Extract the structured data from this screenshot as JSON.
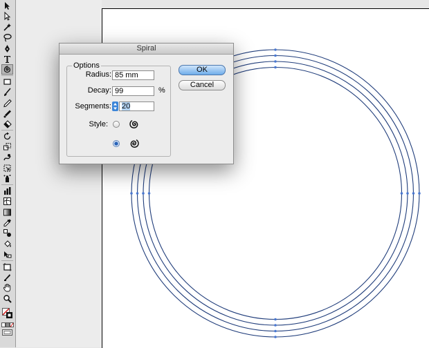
{
  "toolbar": {
    "tools": [
      {
        "icon": "selection-arrow-icon"
      },
      {
        "icon": "direct-selection-icon"
      },
      {
        "icon": "magic-wand-icon"
      },
      {
        "icon": "lasso-icon"
      },
      {
        "icon": "pen-icon"
      },
      {
        "icon": "type-icon",
        "glyph": "T"
      },
      {
        "icon": "spiral-tool-icon",
        "active": true
      },
      {
        "icon": "rectangle-icon"
      },
      {
        "icon": "paintbrush-icon"
      },
      {
        "icon": "pencil-icon"
      },
      {
        "icon": "blob-brush-icon"
      },
      {
        "icon": "eraser-icon"
      },
      {
        "icon": "rotate-icon"
      },
      {
        "icon": "scale-icon"
      },
      {
        "icon": "warp-icon"
      },
      {
        "icon": "free-transform-icon"
      },
      {
        "icon": "symbol-sprayer-icon"
      },
      {
        "icon": "column-graph-icon"
      },
      {
        "icon": "mesh-icon"
      },
      {
        "icon": "gradient-icon"
      },
      {
        "icon": "eyedropper-icon"
      },
      {
        "icon": "blend-icon"
      },
      {
        "icon": "live-paint-bucket-icon"
      },
      {
        "icon": "live-paint-selection-icon"
      },
      {
        "icon": "artboard-icon"
      },
      {
        "icon": "slice-icon"
      },
      {
        "icon": "hand-icon"
      },
      {
        "icon": "zoom-icon"
      }
    ]
  },
  "dialog": {
    "title": "Spiral",
    "options_legend": "Options",
    "radius_label": "Radius:",
    "radius_value": "85 mm",
    "decay_label": "Decay:",
    "decay_value": "99",
    "decay_unit": "%",
    "segments_label": "Segments:",
    "segments_value": "20",
    "style_label": "Style:",
    "styles": [
      {
        "icon": "counterclockwise-spiral-icon",
        "selected": false
      },
      {
        "icon": "clockwise-spiral-icon",
        "selected": true
      }
    ],
    "ok_label": "OK",
    "cancel_label": "Cancel"
  },
  "colors": {
    "path": "#1f3c7a",
    "anchor": "#4a78d0",
    "accent": "#3d86d8"
  }
}
